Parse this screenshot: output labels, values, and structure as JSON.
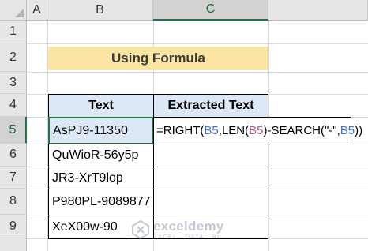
{
  "columns": [
    "A",
    "B",
    "C"
  ],
  "rows": [
    "1",
    "2",
    "3",
    "4",
    "5",
    "6",
    "7",
    "8",
    "9"
  ],
  "active_column": "C",
  "active_row": "5",
  "title": "Using Formula",
  "table": {
    "headers": [
      "Text",
      "Extracted Text"
    ],
    "texts": [
      "AsPJ9-11350",
      "QuWioR-56y5p",
      "JR3-XrT9lop",
      "P980PL-9089877",
      "XeX00w-90"
    ]
  },
  "formula": {
    "parts": [
      "=RIGHT(",
      "B5",
      ",LEN(",
      "B5",
      ")-SEARCH(\"-\",",
      "B5",
      "))"
    ]
  },
  "watermark": {
    "name": "exceldemy",
    "tagline": "EXCEL · DATA · BI"
  },
  "colors": {
    "title_fill": "#fbe5a2",
    "header_fill": "#dde8f6",
    "selection": "#217346",
    "ref_blue": "#4472c4",
    "ref_purple": "#b5608c"
  }
}
